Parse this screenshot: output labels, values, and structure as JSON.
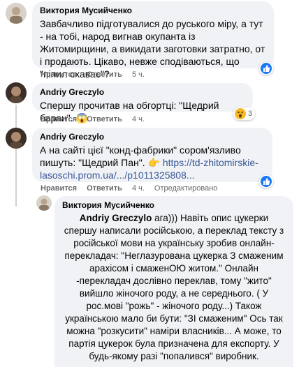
{
  "comments": [
    {
      "author": "Виктория Мусийченко",
      "text": "Завбачливо підготувалися до руського міру, а тут - на тобі, народ вигнав окупанта із Житомирщини, а викидати заготовки затратно, от і продають. Цікаво, невже сподіваються, що \"піпил схаває\"?",
      "like": "Нравится",
      "reply": "Ответить",
      "time": "5 ч.",
      "reaction": "like"
    },
    {
      "author": "Andriy Greczylo",
      "text": "Спершу прочитав на обгортці: \"Щедрий баран\".",
      "emoji": "😱",
      "like": "Нравится",
      "reply": "Ответить",
      "time": "4 ч.",
      "reaction_count": "3"
    },
    {
      "author": "Andriy Greczylo",
      "text_before": "А на сайті цієї \"конд-фабрики\" сором'язливо пишуть: \"Щедрий Пан\". ",
      "link_icon": "👉",
      "link": " https://td-zhitomirskie-lasoschi.prom.ua/.../p1011325808...",
      "like": "Нравится",
      "reply": "Ответить",
      "time": "4 ч.",
      "edited": "Отредактировано",
      "reaction": "like"
    },
    {
      "author": "Виктория Мусийченко",
      "mention": "Andriy Greczylo",
      "text": " ага))) Навіть опис цукерки спершу написали російською, а переклад тексту з російської мови на українську зробив онлайн-перекладач: \"Неглазурована цукерка З смаженим арахісом і смаженОЮ житом.\" Онлайн -перекладач дослівно переклав, тому \"жито\" вийшло жіночого роду, а не середнього. ( У рос.мові \"рожь\" - жіночого роду...) Також українською мало би бути: \"ЗІ смаженим\" Ось так можна \"розкусити\" наміри власників... А може, то партія цукерок була призначена для експорту. У будь-якому разі \"попалився\" виробник."
    }
  ],
  "colors": {
    "bubble": "#f0f2f5",
    "meta": "#65676b",
    "link": "#385898",
    "like_blue": "#1877f2"
  },
  "icons": [
    "avatar",
    "like-reaction-icon",
    "wow-reaction-icon",
    "link-pointer-icon"
  ]
}
